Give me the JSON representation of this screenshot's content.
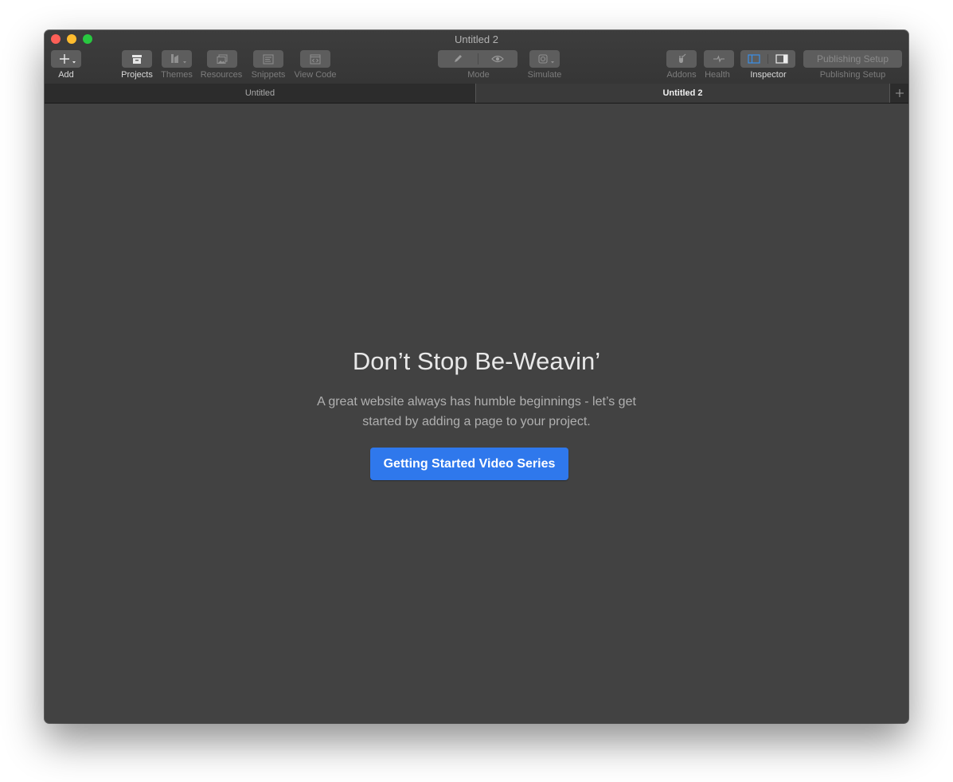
{
  "window": {
    "title": "Untitled 2"
  },
  "toolbar": {
    "add": {
      "icon": "plus-icon",
      "label": "Add"
    },
    "projects": {
      "icon": "archive-box-icon",
      "label": "Projects",
      "active": true
    },
    "themes": {
      "icon": "themes-icon",
      "label": "Themes"
    },
    "resources": {
      "icon": "images-icon",
      "label": "Resources"
    },
    "snippets": {
      "icon": "snippet-icon",
      "label": "Snippets"
    },
    "view_code": {
      "icon": "code-window-icon",
      "label": "View Code"
    },
    "mode": {
      "edit_icon": "pencil-icon",
      "preview_icon": "eye-icon",
      "label": "Mode"
    },
    "simulate": {
      "icon": "simulate-icon",
      "label": "Simulate"
    },
    "addons": {
      "icon": "plug-icon",
      "label": "Addons"
    },
    "health": {
      "icon": "heartbeat-icon",
      "label": "Health"
    },
    "inspector": {
      "left_icon": "sidebar-left-icon",
      "right_icon": "sidebar-right-icon",
      "label": "Inspector",
      "active": true
    },
    "publishing": {
      "button_label": "Publishing Setup",
      "label": "Publishing Setup"
    }
  },
  "tabs": [
    {
      "label": "Untitled",
      "active": false
    },
    {
      "label": "Untitled 2",
      "active": true
    }
  ],
  "empty_state": {
    "heading": "Don’t Stop Be-Weavin’",
    "line1": "A great website always has humble beginnings - let’s get",
    "line2": "started by adding a page to your project.",
    "button": "Getting Started Video Series"
  },
  "colors": {
    "accent": "#2f78ec",
    "active_inspector_icon": "#3b8fe8",
    "window_bg": "#424242",
    "close": "#fe5f57",
    "minimize": "#febc2e",
    "zoom": "#28c840"
  }
}
